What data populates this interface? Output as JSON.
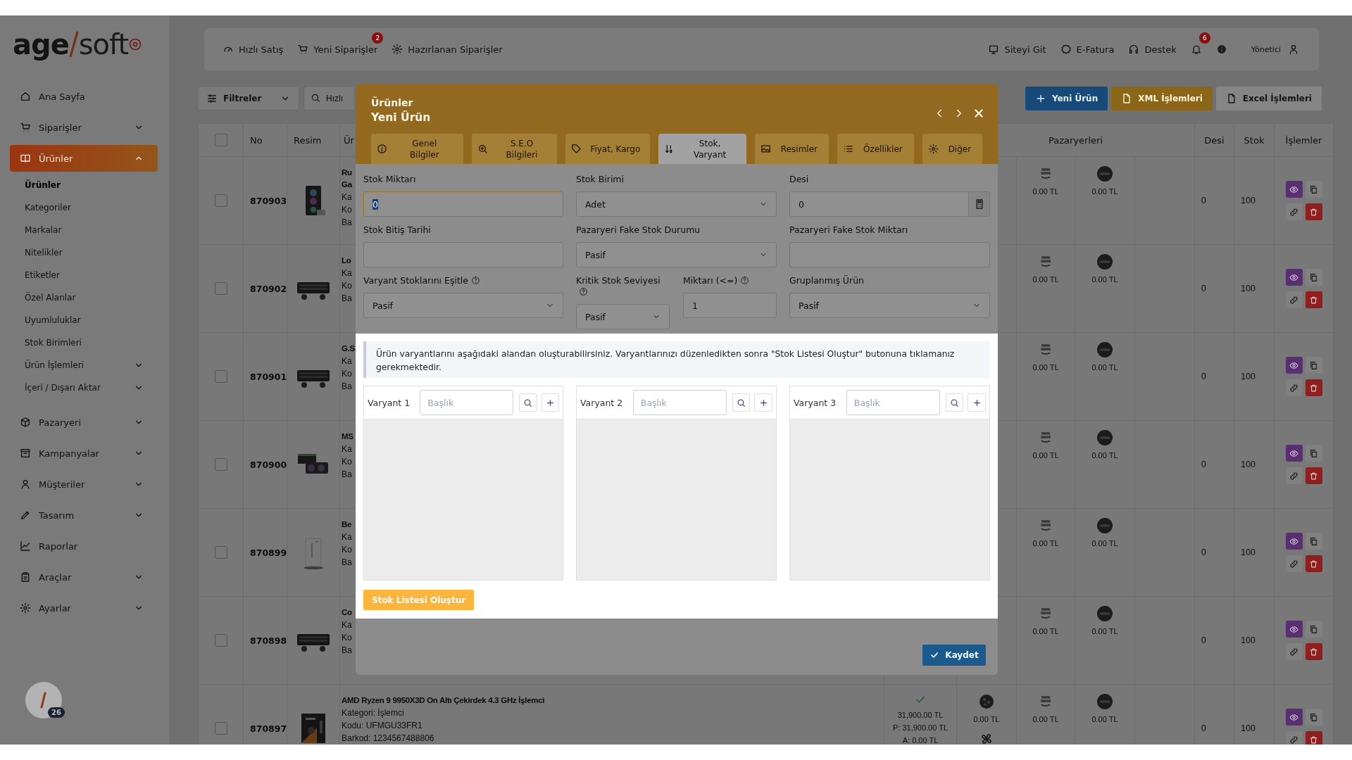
{
  "sidebar": {
    "logo": {
      "first": "age",
      "second": "soft"
    },
    "nav": [
      {
        "label": "Ana Sayfa",
        "kind": "link",
        "selected": false
      },
      {
        "label": "Siparişler",
        "kind": "menu",
        "selected": false,
        "expanded": false
      },
      {
        "label": "Ürünler",
        "kind": "menu",
        "selected": true,
        "expanded": true,
        "children": [
          {
            "label": "Ürünler",
            "kind": "link",
            "selected": true
          },
          {
            "label": "Kategoriler",
            "kind": "link",
            "selected": false
          },
          {
            "label": "Markalar",
            "kind": "link",
            "selected": false
          },
          {
            "label": "Nitelikler",
            "kind": "link",
            "selected": false
          },
          {
            "label": "Etiketler",
            "kind": "link",
            "selected": false
          },
          {
            "label": "Özel Alanlar",
            "kind": "link",
            "selected": false
          },
          {
            "label": "Uyumluluklar",
            "kind": "link",
            "selected": false
          },
          {
            "label": "Stok Birimleri",
            "kind": "link",
            "selected": false
          },
          {
            "label": "Ürün İşlemleri",
            "kind": "menu",
            "selected": false,
            "expanded": false
          },
          {
            "label": "İçeri / Dışarı Aktar",
            "kind": "menu",
            "selected": false,
            "expanded": false
          }
        ]
      },
      {
        "label": "Pazaryeri",
        "kind": "menu",
        "selected": false,
        "expanded": false
      },
      {
        "label": "Kampanyalar",
        "kind": "menu",
        "selected": false,
        "expanded": false
      },
      {
        "label": "Müşteriler",
        "kind": "menu",
        "selected": false,
        "expanded": false
      },
      {
        "label": "Tasarım",
        "kind": "menu",
        "selected": false,
        "expanded": false
      },
      {
        "label": "Raporlar",
        "kind": "link",
        "selected": false
      },
      {
        "label": "Araçlar",
        "kind": "menu",
        "selected": false,
        "expanded": false
      },
      {
        "label": "Ayarlar",
        "kind": "menu",
        "selected": false,
        "expanded": false
      }
    ],
    "user_badge": "26"
  },
  "top_bar": {
    "left_links": [
      {
        "label": "Hızlı Satış"
      },
      {
        "label": "Yeni Siparişler",
        "badge": "2"
      },
      {
        "label": "Hazırlanan Siparişler"
      }
    ],
    "right_links": [
      {
        "label": "Siteyi Git"
      },
      {
        "label": "E-Fatura"
      },
      {
        "label": "Destek"
      }
    ],
    "notification_badge": "6",
    "user": "Yönetici"
  },
  "toolbar": {
    "filter_button": "Filtreler",
    "search": {
      "placeholder": "Hızlı"
    },
    "actions": [
      {
        "label": "Yeni Ürün",
        "kind": "primary"
      },
      {
        "label": "XML İşlemleri",
        "kind": "warning"
      },
      {
        "label": "Excel İşlemleri",
        "kind": "secondary"
      }
    ]
  },
  "table": {
    "columns": [
      "No",
      "Resim",
      "Ür",
      "Pazaryerleri",
      "Desi",
      "Stok",
      "İşlemler"
    ],
    "select_all_checked": false,
    "rows": [
      {
        "checked": false,
        "no": "870903",
        "name_lines": [
          "Ru",
          "Ga"
        ],
        "details": [
          "Ka",
          "Ko",
          "Ba"
        ],
        "marketplace_prices": [
          "0.00 TL",
          "0.00 TL"
        ],
        "desi": "0",
        "stock": "100"
      },
      {
        "checked": false,
        "no": "870902",
        "name_lines": [
          "Lo"
        ],
        "details": [
          "Ka",
          "Ko",
          "Ba"
        ],
        "marketplace_prices": [
          "0.00 TL",
          "0.00 TL"
        ],
        "desi": "0",
        "stock": "100"
      },
      {
        "checked": false,
        "no": "870901",
        "name_lines": [
          "G.S"
        ],
        "details": [
          "Ka",
          "Ko",
          "Ba"
        ],
        "marketplace_prices": [
          "0.00 TL",
          "0.00 TL"
        ],
        "desi": "0",
        "stock": "100"
      },
      {
        "checked": false,
        "no": "870900",
        "name_lines": [
          "MS"
        ],
        "details": [
          "Ka",
          "Ko",
          "Ba"
        ],
        "marketplace_prices": [
          "0.00 TL",
          "0.00 TL"
        ],
        "desi": "0",
        "stock": "100"
      },
      {
        "checked": false,
        "no": "870899",
        "name_lines": [
          "Be"
        ],
        "details": [
          "Ka",
          "Ko",
          "Ba"
        ],
        "marketplace_prices": [
          "0.00 TL",
          "0.00 TL"
        ],
        "desi": "0",
        "stock": "100"
      },
      {
        "checked": false,
        "no": "870898",
        "name_lines": [
          "Co"
        ],
        "details": [
          "Ka",
          "Ko",
          "Ba"
        ],
        "marketplace_prices": [
          "0.00 TL",
          "0.00 TL"
        ],
        "desi": "0",
        "stock": "100"
      },
      {
        "checked": false,
        "no": "870897",
        "name_lines": [
          "AMD Ryzen 9 9950X3D On Altı Çekirdek 4.3 GHz İşlemci"
        ],
        "details": [
          "Kategori: İşlemci",
          "Kodu: UFMGU33FR1",
          "Barkod: 1234567488806"
        ],
        "price_lines": [
          "31,900.00 TL",
          "P: 31,900.00 TL",
          "A: 0.00 TL"
        ],
        "extra_price": "0.00 TL",
        "marketplace_prices": [
          "0.00 TL",
          "0.00 TL"
        ],
        "desi": "0",
        "stock": "100"
      }
    ]
  },
  "modal": {
    "breadcrumb": "Ürünler",
    "title": "Yeni Ürün",
    "tabs": [
      {
        "label": "Genel Bilgiler",
        "selected": false
      },
      {
        "label": "S.E.O Bilgileri",
        "selected": false
      },
      {
        "label": "Fiyat, Kargo",
        "selected": false
      },
      {
        "label": "Stok, Varyant",
        "selected": true
      },
      {
        "label": "Resimler",
        "selected": false
      },
      {
        "label": "Özellikler",
        "selected": false
      },
      {
        "label": "Diğer",
        "selected": false
      }
    ],
    "form_rows": [
      [
        {
          "label": "Stok Miktarı",
          "kind": "input",
          "value": "0",
          "focused": true
        },
        {
          "label": "Stok Birimi",
          "kind": "select",
          "value": "Adet",
          "focused": false
        },
        {
          "label": "Desi",
          "kind": "calc-input",
          "value": "0",
          "focused": false
        }
      ],
      [
        {
          "label": "Stok Bitiş Tarihi",
          "kind": "input",
          "focused": false
        },
        {
          "label": "Pazaryeri Fake Stok Durumu",
          "kind": "select",
          "value": "Pasif",
          "focused": false
        },
        {
          "label": "Pazaryeri Fake Stok Miktarı",
          "kind": "input",
          "focused": false
        }
      ],
      [
        {
          "label": "Varyant Stoklarını Eşitle",
          "kind": "select",
          "value": "Pasif",
          "help": true,
          "focused": false
        },
        {
          "kind": "pair",
          "fields": [
            {
              "label": "Kritik Stok Seviyesi",
              "kind": "select",
              "value": "Pasif",
              "help": true,
              "focused": false
            },
            {
              "label": "Miktarı (<=)",
              "kind": "input",
              "value": "1",
              "help": true,
              "focused": false
            }
          ]
        },
        {
          "label": "Gruplanmış Ürün",
          "kind": "select",
          "value": "Pasif",
          "focused": false
        }
      ]
    ],
    "variant_notice": "Ürün varyantlarını aşağıdaki alandan oluşturabilirsiniz. Varyantlarınızı düzenledikten sonra \"Stok Listesi Oluştur\" butonuna tıklamanız gerekmektedir.",
    "variants": [
      {
        "label": "Varyant 1",
        "placeholder": "Başlık"
      },
      {
        "label": "Varyant 2",
        "placeholder": "Başlık"
      },
      {
        "label": "Varyant 3",
        "placeholder": "Başlık"
      }
    ],
    "generate_button": "Stok Listesi Oluştur",
    "save_button": "Kaydet"
  }
}
